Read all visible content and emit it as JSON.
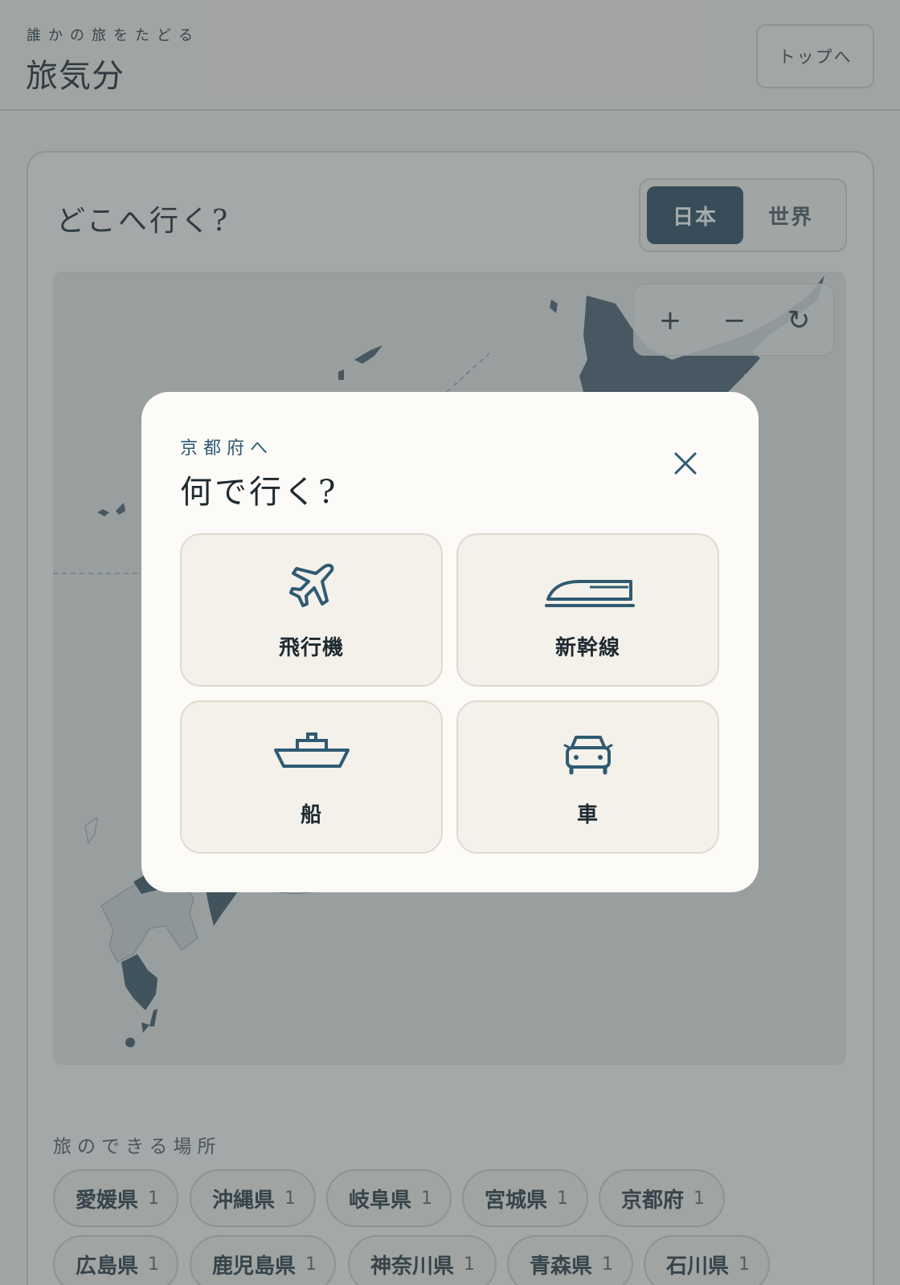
{
  "header": {
    "subtitle": "誰かの旅をたどる",
    "title": "旅気分",
    "top_button": "トップへ"
  },
  "main": {
    "question": "どこへ行く?",
    "region_toggle": {
      "active": "日本",
      "inactive": "世界"
    },
    "zoom": {
      "in": "+",
      "out": "−",
      "reset": "↻"
    }
  },
  "places": {
    "label": "旅のできる場所",
    "items": [
      {
        "name": "愛媛県",
        "count": "1"
      },
      {
        "name": "沖縄県",
        "count": "1"
      },
      {
        "name": "岐阜県",
        "count": "1"
      },
      {
        "name": "宮城県",
        "count": "1"
      },
      {
        "name": "京都府",
        "count": "1"
      },
      {
        "name": "広島県",
        "count": "1"
      },
      {
        "name": "鹿児島県",
        "count": "1"
      },
      {
        "name": "神奈川県",
        "count": "1"
      },
      {
        "name": "青森県",
        "count": "1"
      },
      {
        "name": "石川県",
        "count": "1"
      }
    ]
  },
  "modal": {
    "destination": "京都府へ",
    "title": "何で行く?",
    "options": [
      {
        "label": "飛行機",
        "icon": "airplane-icon"
      },
      {
        "label": "新幹線",
        "icon": "bullet-train-icon"
      },
      {
        "label": "船",
        "icon": "ship-icon"
      },
      {
        "label": "車",
        "icon": "car-icon"
      }
    ]
  },
  "colors": {
    "accent": "#2c4b5f",
    "icon": "#2f5a72",
    "background": "#f4f1ea",
    "overlay": "rgba(70,80,84,0.48)"
  }
}
